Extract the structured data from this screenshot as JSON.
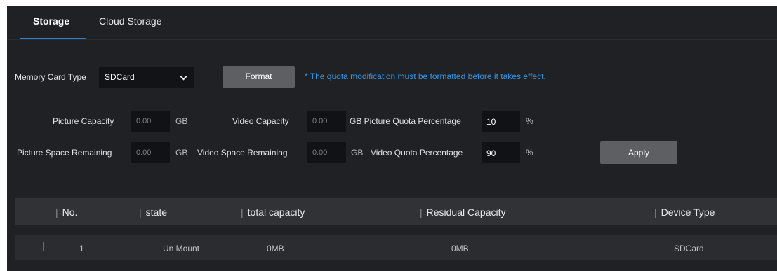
{
  "tabs": [
    {
      "label": "Storage",
      "active": true
    },
    {
      "label": "Cloud Storage",
      "active": false
    }
  ],
  "memory_card": {
    "label": "Memory Card Type",
    "selected": "SDCard",
    "format_button": "Format",
    "note": "* The quota modification must be formatted before it takes effect."
  },
  "capacity": {
    "picture_capacity_label": "Picture Capacity",
    "picture_capacity_value": "0.00",
    "video_capacity_label": "Video Capacity",
    "video_capacity_value": "0.00",
    "picture_quota_label": "GB Picture Quota Percentage",
    "picture_quota_value": "10",
    "picture_remaining_label": "Picture Space Remaining",
    "picture_remaining_value": "0.00",
    "video_remaining_label": "Video Space Remaining",
    "video_remaining_value": "0.00",
    "video_quota_label": "Video Quota Percentage",
    "video_quota_value": "90",
    "unit_gb": "GB",
    "unit_percent": "%",
    "apply_button": "Apply"
  },
  "table": {
    "headers": [
      "No.",
      "state",
      "total capacity",
      "Residual Capacity",
      "Device Type"
    ],
    "rows": [
      {
        "no": "1",
        "state": "Un Mount",
        "total": "0MB",
        "residual": "0MB",
        "device": "SDCard"
      }
    ]
  },
  "colors": {
    "panel_bg": "#202125",
    "accent_blue": "#2f7fd1",
    "note_blue": "#3596e6",
    "button_gray": "#5e5f63"
  }
}
